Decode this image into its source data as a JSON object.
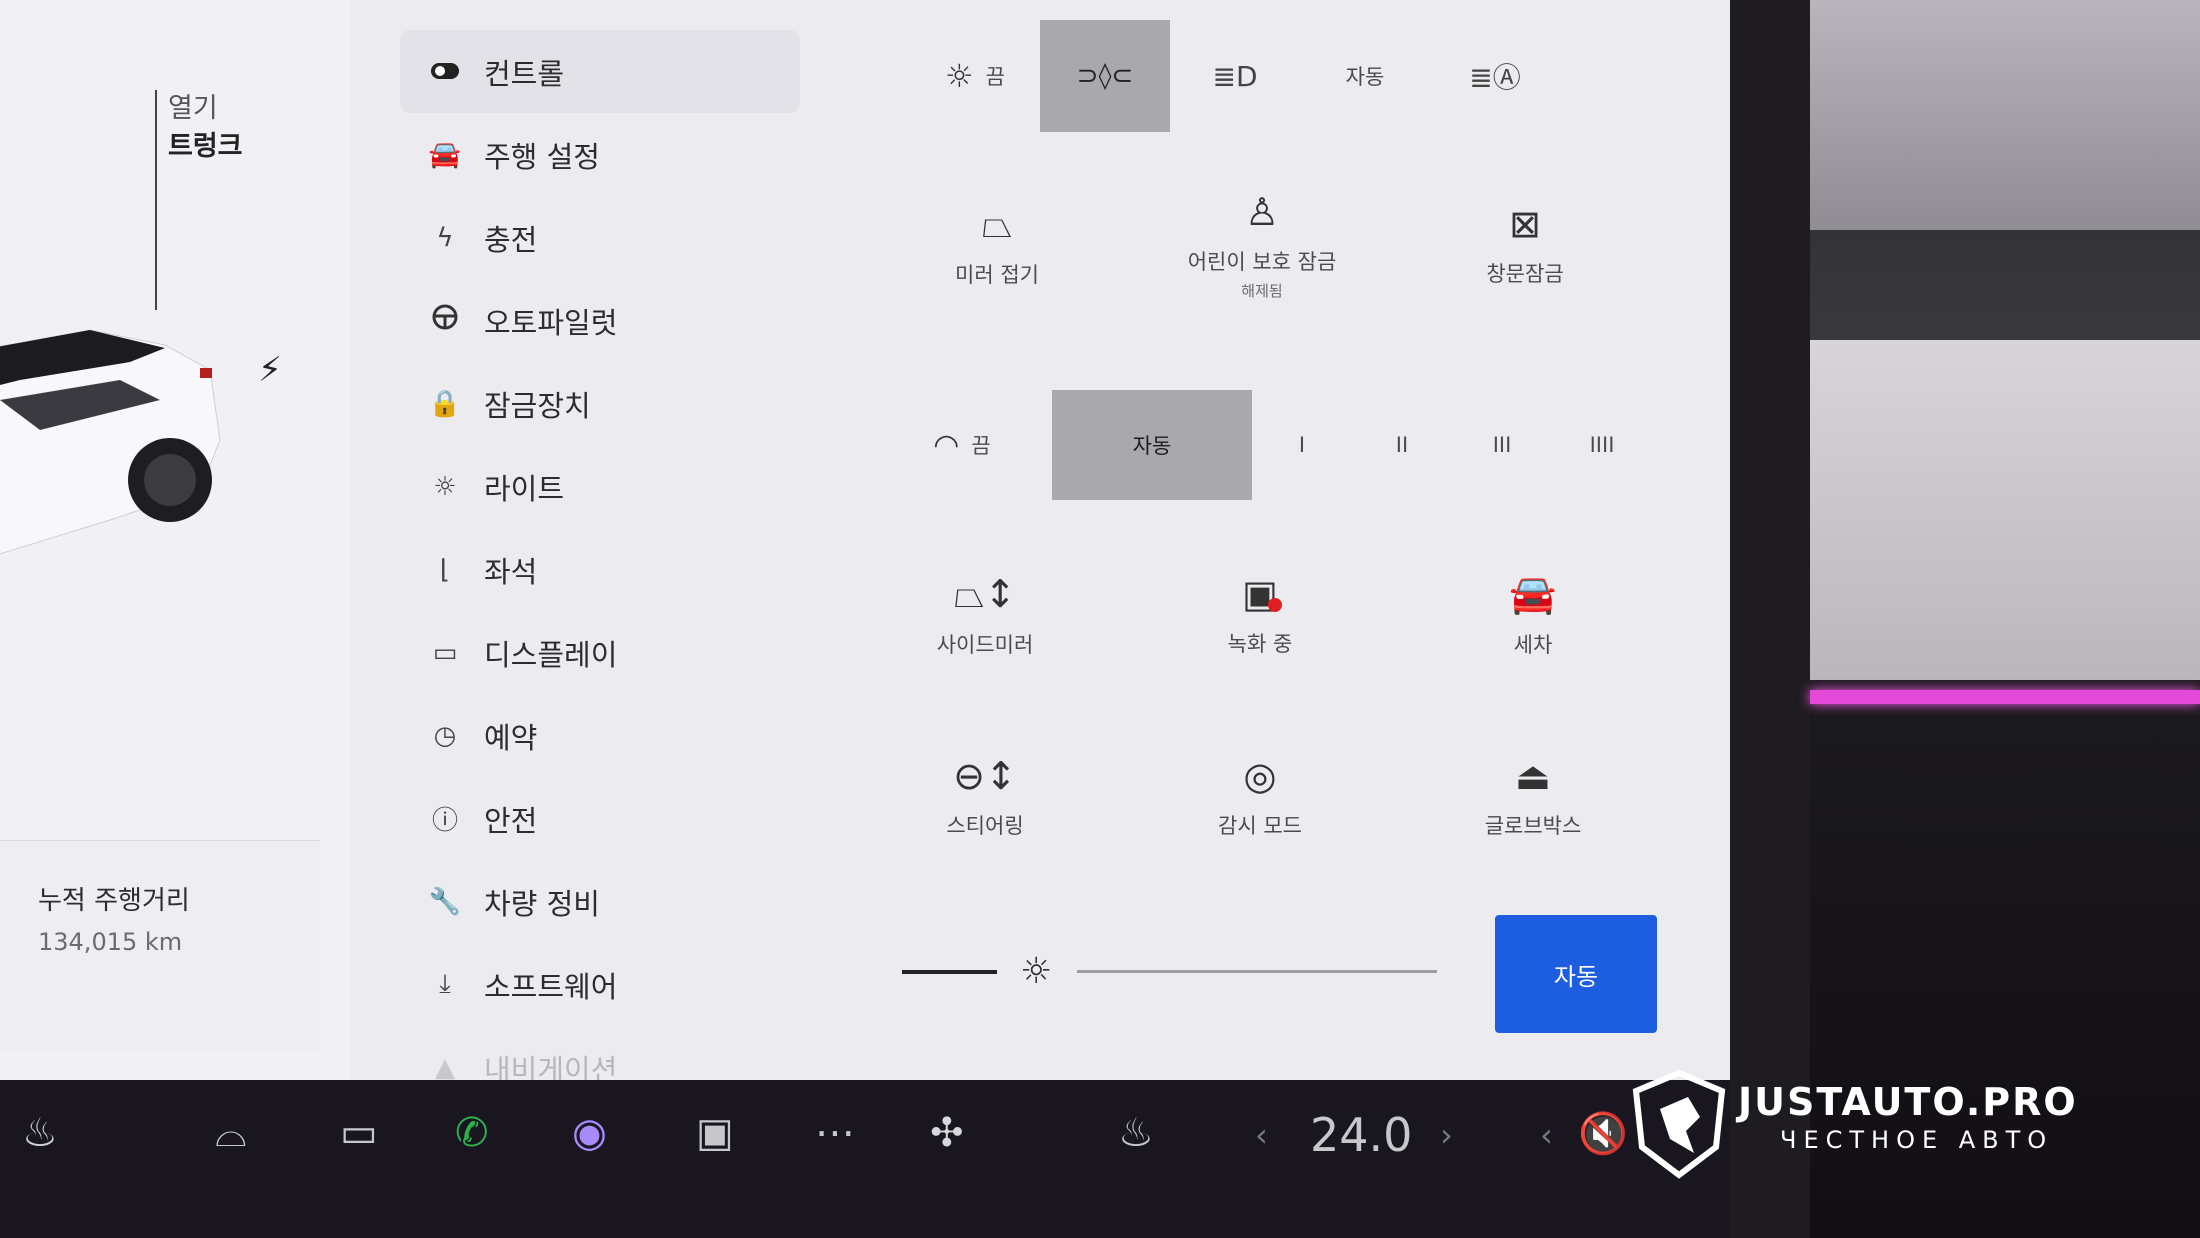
{
  "car_panel": {
    "trunk_open": "열기",
    "trunk_label": "트렁크",
    "odometer_label": "누적 주행거리",
    "odometer_value": "134,015 km"
  },
  "menu": {
    "items": [
      {
        "label": "컨트롤",
        "icon": "toggle-icon"
      },
      {
        "label": "주행 설정",
        "icon": "car-icon"
      },
      {
        "label": "충전",
        "icon": "bolt-icon"
      },
      {
        "label": "오토파일럿",
        "icon": "steering-wheel-icon"
      },
      {
        "label": "잠금장치",
        "icon": "lock-icon"
      },
      {
        "label": "라이트",
        "icon": "sun-icon"
      },
      {
        "label": "좌석",
        "icon": "seat-icon"
      },
      {
        "label": "디스플레이",
        "icon": "display-icon"
      },
      {
        "label": "예약",
        "icon": "schedule-icon"
      },
      {
        "label": "안전",
        "icon": "safety-icon"
      },
      {
        "label": "차량 정비",
        "icon": "wrench-icon"
      },
      {
        "label": "소프트웨어",
        "icon": "download-icon"
      },
      {
        "label": "내비게이션",
        "icon": "navigation-icon"
      }
    ]
  },
  "lights": {
    "off_label": "끔",
    "auto_label": "자동"
  },
  "tiles_row1": {
    "mirror_fold": "미러 접기",
    "child_lock": "어린이 보호 잠금",
    "child_lock_status": "해제됨",
    "window_lock": "창문잠금"
  },
  "wipers": {
    "off_label": "끔",
    "auto_label": "자동",
    "speed1": "I",
    "speed2": "II",
    "speed3": "III",
    "speed4": "IIII"
  },
  "tiles_row2": {
    "side_mirror": "사이드미러",
    "recording": "녹화 중",
    "car_wash": "세차"
  },
  "tiles_row3": {
    "steering": "스티어링",
    "sentry": "감시 모드",
    "glovebox": "글로브박스"
  },
  "brightness": {
    "auto_label": "자동"
  },
  "taskbar": {
    "temperature": "24.0"
  },
  "watermark": {
    "name": "JUSTAUTO.PRO",
    "tagline": "ЧЕСТНОЕ АВТО"
  },
  "colors": {
    "accent_blue": "#1d5ee0",
    "record_red": "#e02020",
    "phone_green": "#2bb24c",
    "ambient_pink": "#e44ad8"
  }
}
